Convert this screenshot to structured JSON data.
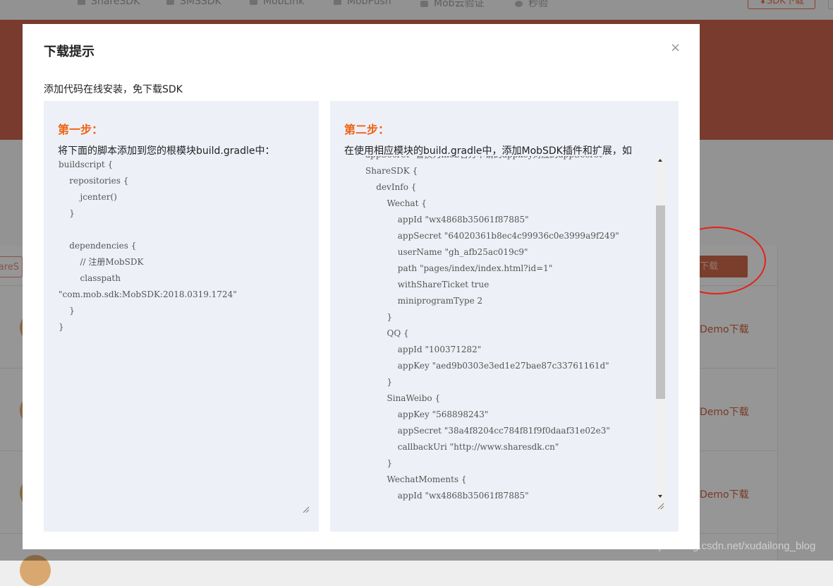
{
  "background": {
    "nav_items": [
      {
        "label": "ShareSDK"
      },
      {
        "label": "SMSSDK"
      },
      {
        "label": "MobLink"
      },
      {
        "label": "MobPush"
      },
      {
        "label": "Mob云验证"
      },
      {
        "label": "秒验"
      }
    ],
    "sdk_download_label": "SDK下载",
    "left_tab_label": "hareS",
    "download_button_label": "下载",
    "demo_download_label": "Demo下载",
    "watermark": "https://blog.csdn.net/xudailong_blog",
    "accent_color": "#c2604a",
    "annotation_color": "#e2231a"
  },
  "modal": {
    "title": "下载提示",
    "close_label": "×",
    "subtitle": "添加代码在线安装，免下载SDK",
    "step1": {
      "title": "第一步：",
      "desc": "将下面的脚本添加到您的根模块build.gradle中：",
      "code": "buildscript {\n    repositories {\n        jcenter()\n    }\n\n    dependencies {\n        // 注册MobSDK\n        classpath\n\"com.mob.sdk:MobSDK:2018.0319.1724\"\n    }\n}"
    },
    "step2": {
      "title": "第二步：",
      "desc": "在使用相应模块的build.gradle中，添加MobSDK插件和扩展，如",
      "code": "appSecret \"替换为mob官方申请的appkey对应的appSecret\"\n\nShareSDK {\n\n    devInfo {\n\n        Wechat {\n\n            appId \"wx4868b35061f87885\"\n\n            appSecret \"64020361b8ec4c99936c0e3999a9f249\"\n\n            userName \"gh_afb25ac019c9\"\n\n            path \"pages/index/index.html?id=1\"\n\n            withShareTicket true\n\n            miniprogramType 2\n\n        }\n\n        QQ {\n\n            appId \"100371282\"\n\n            appKey \"aed9b0303e3ed1e27bae87c33761161d\"\n\n        }\n\n        SinaWeibo {\n\n            appKey \"568898243\"\n\n            appSecret \"38a4f8204cc784f81f9f0daaf31e02e3\"\n\n            callbackUri \"http://www.sharesdk.cn\"\n\n        }\n\n        WechatMoments {\n\n            appId \"wx4868b35061f87885\""
    }
  }
}
